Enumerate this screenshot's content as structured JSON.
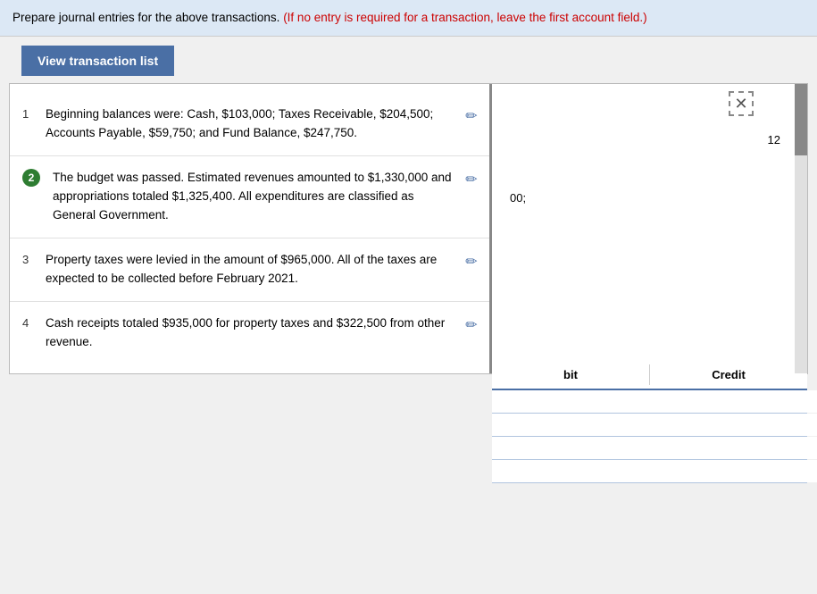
{
  "instruction": {
    "normal_text": "Prepare journal entries for the above transactions.",
    "red_text": "(If no entry is required for a transaction, leave the first account field.)"
  },
  "view_button": {
    "label": "View transaction list"
  },
  "close_icon": "✕",
  "right_number": "12",
  "right_partial": "00;",
  "transactions": [
    {
      "number": "1",
      "circle": false,
      "text": "Beginning balances were: Cash, $103,000; Taxes Receivable, $204,500; Accounts Payable, $59,750; and Fund Balance, $247,750."
    },
    {
      "number": "2",
      "circle": true,
      "text": "The budget was passed. Estimated revenues amounted to $1,330,000 and appropriations totaled $1,325,400. All expenditures are classified as General Government."
    },
    {
      "number": "3",
      "circle": false,
      "text": "Property taxes were levied in the amount of $965,000. All of the taxes are expected to be collected before February 2021."
    },
    {
      "number": "4",
      "circle": false,
      "text": "Cash receipts totaled $935,000 for property taxes and $322,500 from other revenue."
    }
  ],
  "journal": {
    "debit_label": "bit",
    "credit_label": "Credit",
    "rows": [
      {
        "debit": "",
        "credit": ""
      },
      {
        "debit": "",
        "credit": ""
      },
      {
        "debit": "",
        "credit": ""
      },
      {
        "debit": "",
        "credit": ""
      }
    ]
  }
}
